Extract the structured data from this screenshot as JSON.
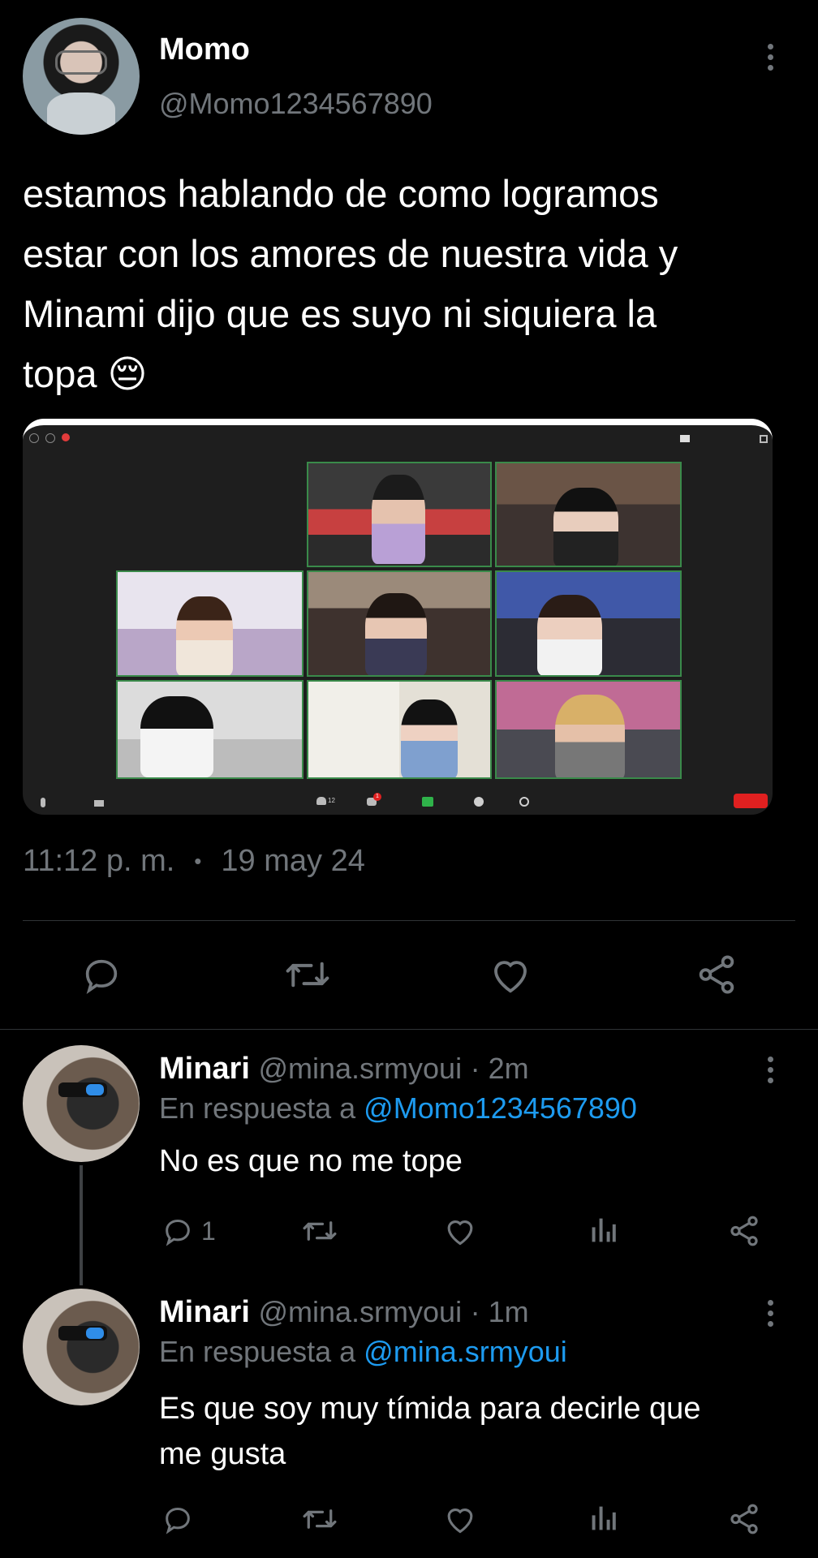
{
  "main_tweet": {
    "author_name": "Momo",
    "author_handle": "@Momo1234567890",
    "text_lines": [
      "estamos hablando de como logramos",
      "estar con los amores de nuestra vida y",
      "Minami dijo que es suyo ni siquiera la",
      "topa 😔"
    ],
    "time": "11:12 p. m.",
    "separator": "•",
    "date": "19 may 24"
  },
  "video_call": {
    "participants_count": "12",
    "chat_badge": "1"
  },
  "replies": [
    {
      "author_name": "Minari",
      "author_handle": "@mina.srmyoui",
      "age": "· 2m",
      "reply_prefix": "En respuesta a",
      "reply_to": "@Momo1234567890",
      "text_lines": [
        "No es que no me tope"
      ],
      "reply_count": "1"
    },
    {
      "author_name": "Minari",
      "author_handle": "@mina.srmyoui",
      "age": "· 1m",
      "reply_prefix": "En respuesta a",
      "reply_to": "@mina.srmyoui",
      "text_lines": [
        "Es que soy muy tímida para decirle que",
        "me gusta"
      ],
      "reply_count": ""
    }
  ],
  "colors": {
    "background": "#000000",
    "link": "#1d9bf0",
    "muted": "#71767b",
    "text": "#e7e9ea",
    "end_call": "#e02020"
  },
  "icons": [
    "reply-icon",
    "retweet-icon",
    "like-icon",
    "share-icon",
    "views-icon",
    "more-icon"
  ]
}
